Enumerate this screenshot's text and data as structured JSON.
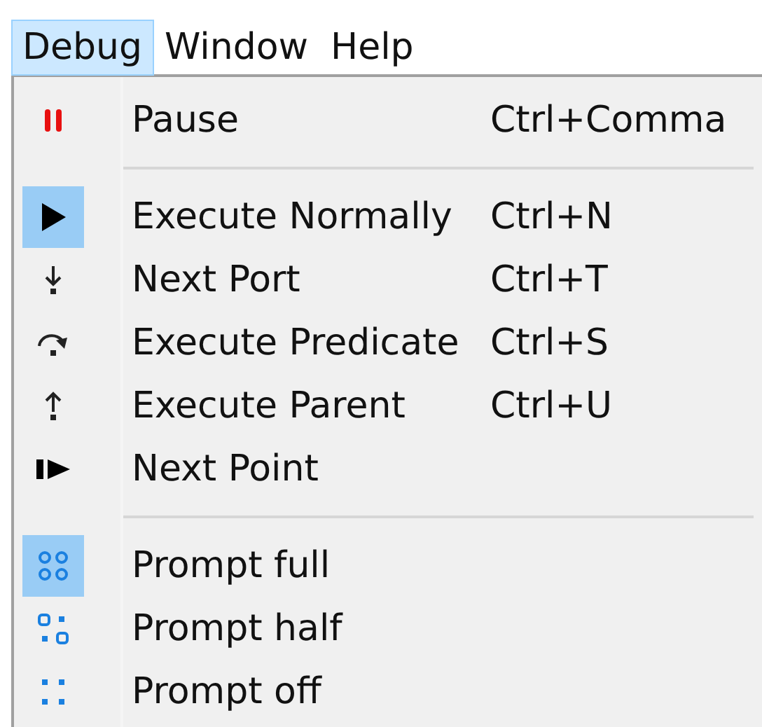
{
  "menubar": [
    {
      "label": "Debug",
      "selected": true
    },
    {
      "label": "Window",
      "selected": false
    },
    {
      "label": "Help",
      "selected": false
    }
  ],
  "menu": [
    {
      "kind": "item",
      "label": "Pause",
      "shortcut": "Ctrl+Comma",
      "checked": false
    },
    {
      "kind": "separator"
    },
    {
      "kind": "item",
      "label": "Execute Normally",
      "shortcut": "Ctrl+N",
      "checked": true
    },
    {
      "kind": "item",
      "label": "Next Port",
      "shortcut": "Ctrl+T",
      "checked": false
    },
    {
      "kind": "item",
      "label": "Execute Predicate",
      "shortcut": "Ctrl+S",
      "checked": false
    },
    {
      "kind": "item",
      "label": "Execute Parent",
      "shortcut": "Ctrl+U",
      "checked": false
    },
    {
      "kind": "item",
      "label": "Next Point",
      "checked": false
    },
    {
      "kind": "separator"
    },
    {
      "kind": "item",
      "label": "Prompt full",
      "checked": true
    },
    {
      "kind": "item",
      "label": "Prompt half",
      "checked": false
    },
    {
      "kind": "item",
      "label": "Prompt off",
      "checked": false
    }
  ]
}
